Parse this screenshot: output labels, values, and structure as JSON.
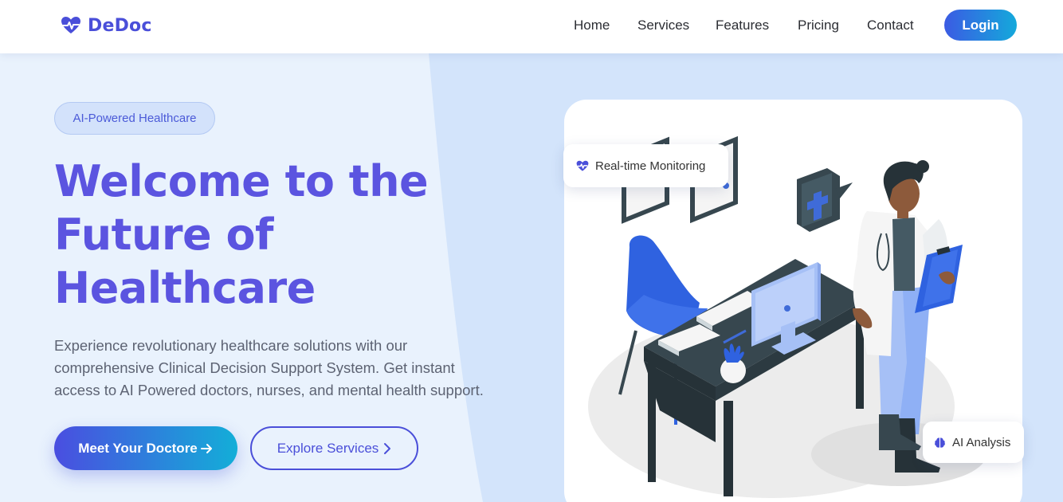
{
  "brand": {
    "name": "DeDoc",
    "logo_icon": "heart-pulse-icon",
    "color": "#4a4fd9"
  },
  "nav": {
    "items": [
      {
        "label": "Home"
      },
      {
        "label": "Services"
      },
      {
        "label": "Features"
      },
      {
        "label": "Pricing"
      },
      {
        "label": "Contact"
      }
    ],
    "login_label": "Login"
  },
  "hero": {
    "badge": "AI-Powered Healthcare",
    "title_lines": [
      "Welcome to the",
      "Future of",
      "Healthcare"
    ],
    "subtitle_lines": [
      "Experience revolutionary healthcare solutions with our",
      "comprehensive Clinical Decision Support System. Get instant",
      "access to AI Powered doctors, nurses, and mental health support."
    ],
    "primary_button": {
      "label": "Meet Your Doctore",
      "icon": "arrow-right-icon"
    },
    "secondary_button": {
      "label": "Explore Services",
      "icon": "chevron-right-icon"
    }
  },
  "illustration": {
    "chips": [
      {
        "label": "Real-time Monitoring",
        "icon": "heart-pulse-icon"
      },
      {
        "label": "AI Analysis",
        "icon": "brain-icon"
      }
    ]
  },
  "colors": {
    "accent": "#5b54e0",
    "gradient_start": "#3b5be3",
    "gradient_end": "#14a9db",
    "background": "#e6f0fd"
  }
}
